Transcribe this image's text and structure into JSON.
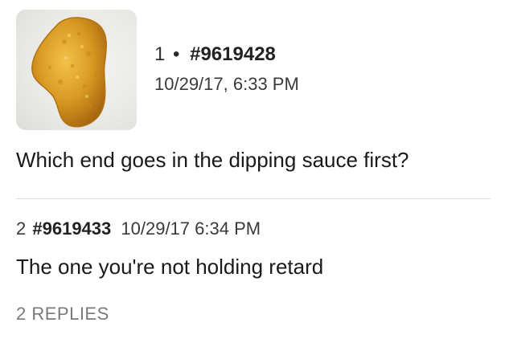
{
  "post": {
    "thumbnail_icon": "chicken-nugget-image",
    "number": "1",
    "separator": "•",
    "id": "#9619428",
    "timestamp": "10/29/17, 6:33 PM",
    "body": "Which end goes in the dipping sauce first?"
  },
  "reply": {
    "number": "2",
    "id": "#9619433",
    "timestamp": "10/29/17 6:34 PM",
    "body": "The one you're not holding retard"
  },
  "replies_link": "2 REPLIES"
}
